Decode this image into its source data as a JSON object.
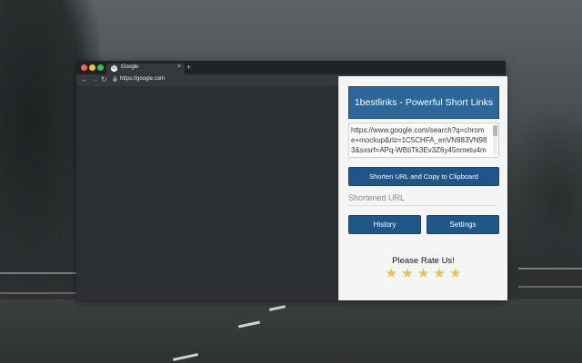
{
  "browser": {
    "tab_title": "Google",
    "tab_close": "×",
    "new_tab": "+",
    "back": "←",
    "forward": "→",
    "reload": "↻",
    "url": "https://google.com",
    "tab_favicon": "G"
  },
  "popup": {
    "title": "1bestlinks - Powerful Short Links",
    "url_text": "https://www.google.com/search?q=chrome+mockup&rlz=1C5CHFA_enVN983VN983&sxsrf=APq-WBtiTk3Ev3Z6y45nmetu4m5Q",
    "shorten_button": "Shorten URL and Copy to Clipboard",
    "shortened_placeholder": "Shortened URL",
    "history_button": "History",
    "settings_button": "Settings",
    "rate_text": "Please Rate Us!",
    "stars": [
      "★",
      "★",
      "★",
      "★",
      "★"
    ]
  },
  "colors": {
    "header_blue": "#2b6799",
    "button_blue": "#1f5689",
    "star_gold": "#f1c232"
  }
}
